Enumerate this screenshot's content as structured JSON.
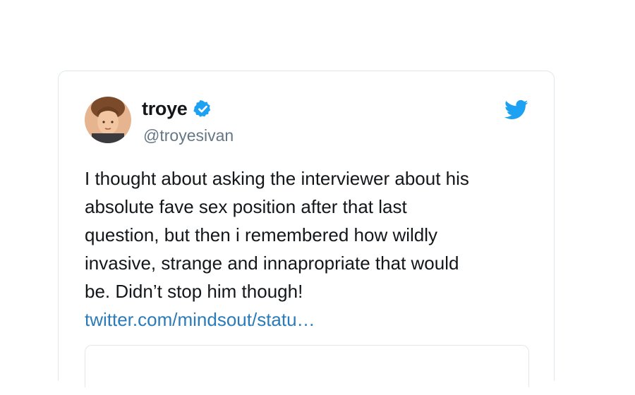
{
  "tweet": {
    "display_name": "troye",
    "handle": "@troyesivan",
    "text_lines": [
      "I thought about asking the interviewer about his",
      "absolute fave sex position after that last",
      "question, but then i remembered how wildly",
      "invasive, strange and innapropriate that would",
      "be. Didn’t stop him though!"
    ],
    "link": "twitter.com/mindsout/statu…"
  },
  "colors": {
    "twitter_blue": "#1da1f2",
    "link": "#2b7bb9",
    "text": "#14171a",
    "muted": "#657786"
  },
  "icons": {
    "verified": "verified-badge-icon",
    "brand": "twitter-bird-icon"
  }
}
